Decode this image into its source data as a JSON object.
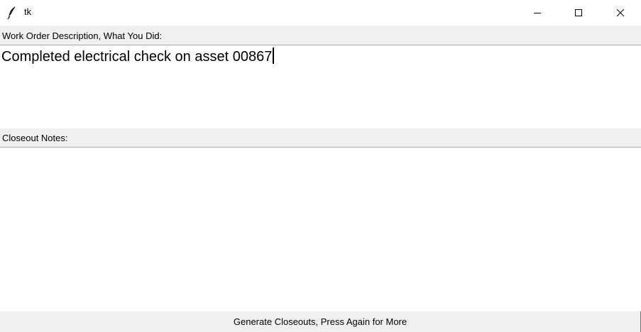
{
  "window": {
    "title": "tk",
    "app_icon": "feather-icon",
    "controls": {
      "minimize_icon": "minimize-icon",
      "maximize_icon": "maximize-icon",
      "close_icon": "close-icon"
    }
  },
  "description": {
    "label": "Work Order Description, What You Did:",
    "value": "Completed electrical check on asset 00867"
  },
  "notes": {
    "label": "Closeout Notes:",
    "value": ""
  },
  "generate_button": {
    "label": "Generate Closeouts, Press Again for More"
  },
  "colors": {
    "window_bg": "#f0f0f0",
    "text_bg": "#ffffff",
    "titlebar_bg": "#ffffff",
    "text": "#000000"
  }
}
